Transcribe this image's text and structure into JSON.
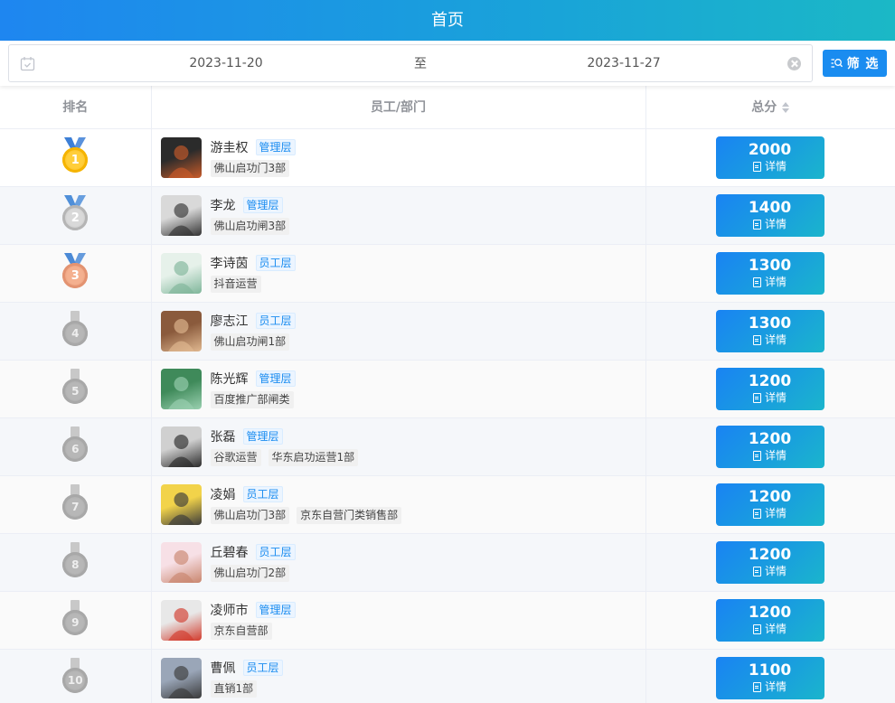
{
  "header": {
    "title": "首页"
  },
  "filter": {
    "start_date": "2023-11-20",
    "separator": "至",
    "end_date": "2023-11-27",
    "button_label": "筛 选"
  },
  "table": {
    "columns": [
      "排名",
      "员工/部门",
      "总分"
    ],
    "detail_label": "详情",
    "rows": [
      {
        "rank": "1",
        "medal": "gold",
        "name": "游圭权",
        "level": "管理层",
        "depts": [
          "佛山启功门3部"
        ],
        "score": "2000",
        "avatar_colors": [
          "#2b2b2b",
          "#c95b2a"
        ]
      },
      {
        "rank": "2",
        "medal": "silver",
        "name": "李龙",
        "level": "管理层",
        "depts": [
          "佛山启功闸3部"
        ],
        "score": "1400",
        "avatar_colors": [
          "#d9d9d9",
          "#333333"
        ]
      },
      {
        "rank": "3",
        "medal": "bronze",
        "name": "李诗茵",
        "level": "员工层",
        "depts": [
          "抖音运营"
        ],
        "score": "1300",
        "avatar_colors": [
          "#e6f1ea",
          "#7fb69a"
        ]
      },
      {
        "rank": "4",
        "medal": "grey",
        "name": "廖志江",
        "level": "员工层",
        "depts": [
          "佛山启功闸1部"
        ],
        "score": "1300",
        "avatar_colors": [
          "#8a5a3c",
          "#e0b890"
        ]
      },
      {
        "rank": "5",
        "medal": "grey",
        "name": "陈光辉",
        "level": "管理层",
        "depts": [
          "百度推广部闸类"
        ],
        "score": "1200",
        "avatar_colors": [
          "#3f8a5a",
          "#9ad0b0"
        ]
      },
      {
        "rank": "6",
        "medal": "grey",
        "name": "张磊",
        "level": "管理层",
        "depts": [
          "谷歌运营",
          "华东启功运营1部"
        ],
        "score": "1200",
        "avatar_colors": [
          "#d0d0d0",
          "#2a2a2a"
        ]
      },
      {
        "rank": "7",
        "medal": "grey",
        "name": "凌娟",
        "level": "员工层",
        "depts": [
          "佛山启功门3部",
          "京东自营门类销售部"
        ],
        "score": "1200",
        "avatar_colors": [
          "#f2d34a",
          "#3b3b3b"
        ]
      },
      {
        "rank": "8",
        "medal": "grey",
        "name": "丘碧春",
        "level": "员工层",
        "depts": [
          "佛山启功门2部"
        ],
        "score": "1200",
        "avatar_colors": [
          "#f7e0e6",
          "#c9866e"
        ]
      },
      {
        "rank": "9",
        "medal": "grey",
        "name": "凌师市",
        "level": "管理层",
        "depts": [
          "京东自营部"
        ],
        "score": "1200",
        "avatar_colors": [
          "#e8e8e8",
          "#d23b2c"
        ]
      },
      {
        "rank": "10",
        "medal": "grey",
        "name": "曹佩",
        "level": "员工层",
        "depts": [
          "直销1部"
        ],
        "score": "1100",
        "avatar_colors": [
          "#9aa6b8",
          "#3a3a3a"
        ]
      }
    ]
  },
  "colors": {
    "accent": "#1a8cf0",
    "header_gradient_end": "#1bb8c6",
    "tag_blue": "#1a8cf0"
  },
  "icons": {
    "calendar": "calendar-icon",
    "clear": "clear-icon",
    "filter": "filter-search-icon",
    "sort": "sort-caret-icon",
    "detail": "document-icon"
  }
}
